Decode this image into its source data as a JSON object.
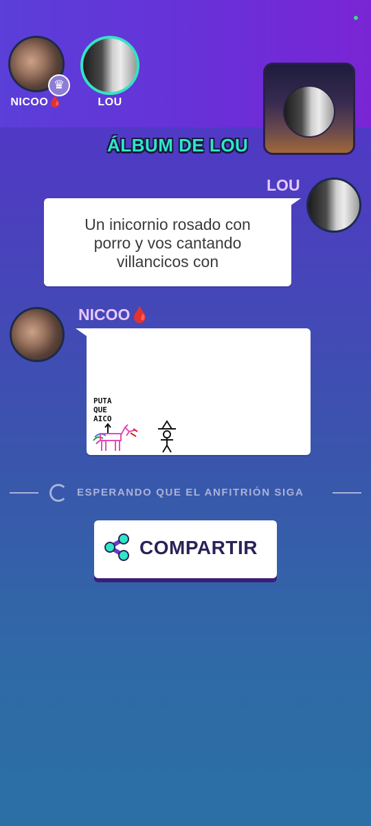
{
  "players": [
    {
      "name": "NICOO🩸",
      "is_host": true
    },
    {
      "name": "LOU",
      "is_active": true
    }
  ],
  "album": {
    "title": "ÁLBUM DE LOU"
  },
  "messages": [
    {
      "author": "LOU",
      "text_lines": [
        "Un inicornio rosado con",
        "porro y vos cantando",
        "villancicos con"
      ]
    },
    {
      "author": "NICOO🩸",
      "drawing_text": [
        "PUTA",
        "QUE",
        "AICO"
      ]
    }
  ],
  "status": {
    "waiting_text": "ESPERANDO QUE EL ANFITRIÓN SIGA"
  },
  "share": {
    "label": "COMPARTIR"
  },
  "colors": {
    "accent_teal": "#2ee6c8",
    "name_pink": "#e7c8ff",
    "button_text": "#2a2258"
  }
}
